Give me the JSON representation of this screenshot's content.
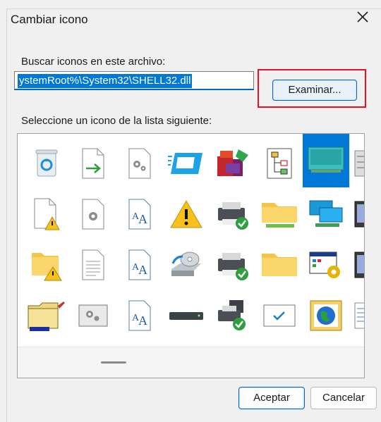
{
  "dialog": {
    "title": "Cambiar icono",
    "close_icon": "close-icon",
    "search_label": "Buscar iconos en este archivo:",
    "path_value": "ystemRoot%\\System32\\SHELL32.dll",
    "browse_label": "Examinar...",
    "list_label": "Seleccione un icono de la lista siguiente:",
    "ok_label": "Aceptar",
    "cancel_label": "Cancelar",
    "highlight_color": "#e81123",
    "selection_color": "#0078d7"
  },
  "icons": [
    [
      "recycle-bin-icon",
      "shortcut-arrow-document-icon",
      "settings-document-icon",
      "monitor-window-icon",
      "app-installer-icon",
      "tree-diagram-icon",
      "desktop-computer-icon",
      "server-icon"
    ],
    [
      "document-warning-icon",
      "settings-document-icon",
      "font-document-icon",
      "warning-icon",
      "printer-ok-icon",
      "folder-network-icon",
      "network-computers-icon",
      "server-icon"
    ],
    [
      "folder-warning-icon",
      "text-document-icon",
      "font-document-icon",
      "disc-drive-icon",
      "printer-ok-icon",
      "folder-icon",
      "window-settings-icon",
      "server-icon"
    ],
    [
      "folder-note-icon",
      "settings-window-icon",
      "font-document-icon",
      "hard-drive-icon",
      "network-printer-icon",
      "checkbox-icon",
      "globe-icon",
      "list-document-icon"
    ]
  ]
}
